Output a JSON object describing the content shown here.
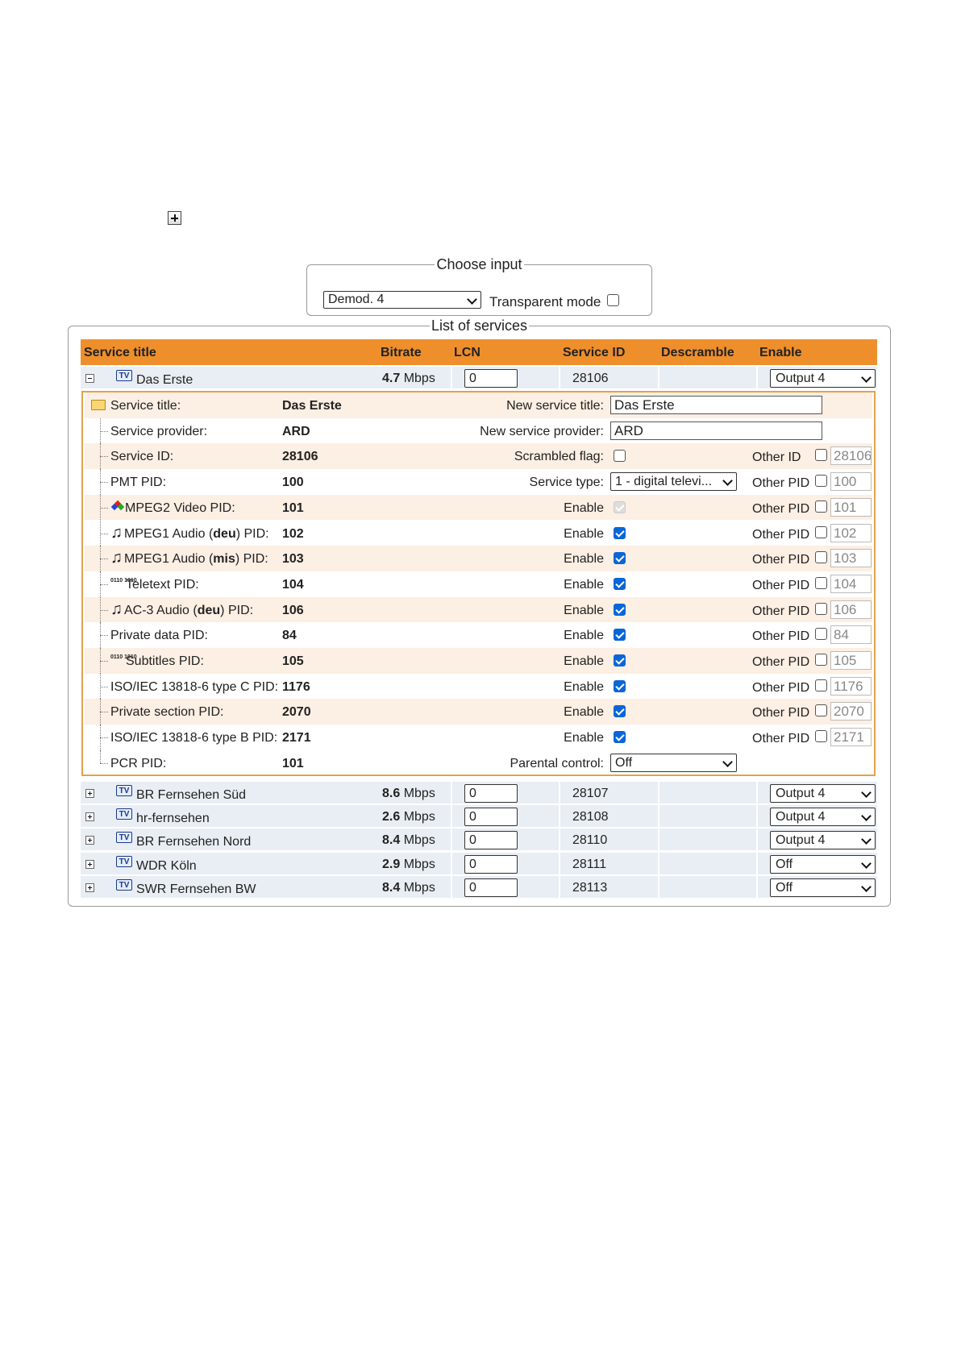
{
  "choose_input": {
    "legend": "Choose input",
    "selected": "Demod. 4",
    "transparent_mode_label": "Transparent mode"
  },
  "list": {
    "legend": "List of services",
    "headers": {
      "service_title": "Service title",
      "bitrate": "Bitrate",
      "lcn": "LCN",
      "service_id": "Service ID",
      "descramble": "Descramble",
      "enable": "Enable"
    },
    "icon_tv": "TV",
    "expanded_service": {
      "title": "Das Erste",
      "bitrate_value": "4.7",
      "bitrate_unit": "Mbps",
      "lcn": "0",
      "service_id": "28106",
      "enable": "Output 4"
    },
    "details": {
      "service_title": {
        "label": "Service title:",
        "value": "Das Erste",
        "right_label": "New service title:",
        "right_value": "Das Erste"
      },
      "service_provider": {
        "label": "Service provider:",
        "value": "ARD",
        "right_label": "New service provider:",
        "right_value": "ARD"
      },
      "service_id": {
        "label": "Service ID:",
        "value": "28106",
        "right_label": "Scrambled flag:",
        "other_label": "Other ID",
        "other_value": "28106"
      },
      "pmt": {
        "label": "PMT PID:",
        "value": "100",
        "right_label": "Service type:",
        "service_type": "1 - digital televi...",
        "other_label": "Other PID",
        "other_value": "100"
      },
      "enable_label": "Enable",
      "other_pid_label": "Other PID",
      "pids": [
        {
          "icon": "video-icon",
          "label": "MPEG2 Video PID:",
          "value": "101",
          "enabled": "disabled",
          "other": "101"
        },
        {
          "icon": "audio-icon",
          "label_pre": "MPEG1 Audio (",
          "lang": "deu",
          "label_post": ") PID:",
          "value": "102",
          "enabled": "checked",
          "other": "102"
        },
        {
          "icon": "audio-icon",
          "label_pre": "MPEG1 Audio (",
          "lang": "mis",
          "label_post": ") PID:",
          "value": "103",
          "enabled": "checked",
          "other": "103"
        },
        {
          "icon": "data-icon",
          "label": "Teletext PID:",
          "value": "104",
          "enabled": "checked",
          "other": "104"
        },
        {
          "icon": "audio-icon",
          "label_pre": "AC-3 Audio (",
          "lang": "deu",
          "label_post": ") PID:",
          "value": "106",
          "enabled": "checked",
          "other": "106"
        },
        {
          "icon": "",
          "label": "Private data PID:",
          "value": "84",
          "enabled": "checked",
          "other": "84"
        },
        {
          "icon": "data-icon",
          "label": "Subtitles PID:",
          "value": "105",
          "enabled": "checked",
          "other": "105"
        },
        {
          "icon": "",
          "label": "ISO/IEC 13818-6 type C PID:",
          "value": "1176",
          "enabled": "checked",
          "other": "1176"
        },
        {
          "icon": "",
          "label": "Private section PID:",
          "value": "2070",
          "enabled": "checked",
          "other": "2070"
        },
        {
          "icon": "",
          "label": "ISO/IEC 13818-6 type B PID:",
          "value": "2171",
          "enabled": "checked",
          "other": "2171"
        }
      ],
      "pcr": {
        "label": "PCR PID:",
        "value": "101",
        "right_label": "Parental control:",
        "parental": "Off"
      },
      "data_icon_text": "0110 1010"
    },
    "collapsed_services": [
      {
        "title": "BR Fernsehen Süd",
        "bitrate_value": "8.6",
        "bitrate_unit": "Mbps",
        "lcn": "0",
        "service_id": "28107",
        "enable": "Output 4"
      },
      {
        "title": "hr-fernsehen",
        "bitrate_value": "2.6",
        "bitrate_unit": "Mbps",
        "lcn": "0",
        "service_id": "28108",
        "enable": "Output 4"
      },
      {
        "title": "BR Fernsehen Nord",
        "bitrate_value": "8.4",
        "bitrate_unit": "Mbps",
        "lcn": "0",
        "service_id": "28110",
        "enable": "Output 4"
      },
      {
        "title": "WDR Köln",
        "bitrate_value": "2.9",
        "bitrate_unit": "Mbps",
        "lcn": "0",
        "service_id": "28111",
        "enable": "Off"
      },
      {
        "title": "SWR Fernsehen BW",
        "bitrate_value": "8.4",
        "bitrate_unit": "Mbps",
        "lcn": "0",
        "service_id": "28113",
        "enable": "Off"
      }
    ]
  },
  "colors": {
    "header_orange": "#ee8f2c",
    "detail_alt_row": "#fcefe3",
    "row_bg": "#e8eef3",
    "checkbox_blue": "#0a66d8"
  }
}
